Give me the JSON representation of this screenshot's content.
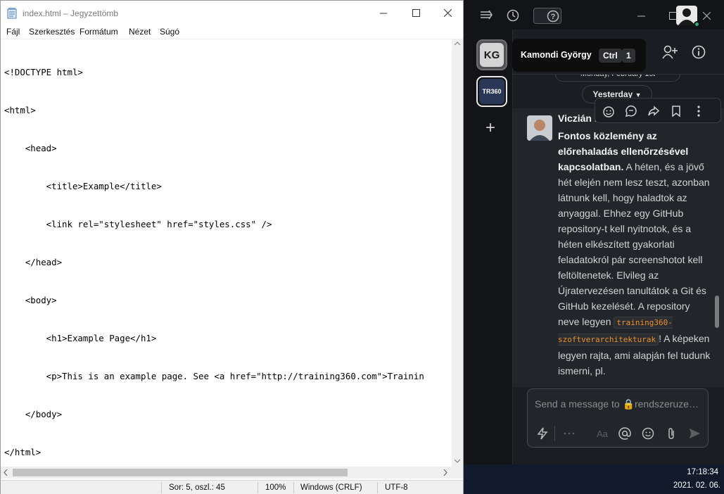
{
  "notepad": {
    "title": "index.html – Jegyzettömb",
    "menu": [
      "Fájl",
      "Szerkesztés",
      "Formátum",
      "Nézet",
      "Súgó"
    ],
    "lines": [
      "<!DOCTYPE html>",
      "<html>",
      "    <head>",
      "        <title>Example</title>",
      "        <link rel=\"stylesheet\" href=\"styles.css\" />",
      "    </head>",
      "    <body>",
      "        <h1>Example Page</h1>",
      "        <p>This is an example page. See <a href=\"http://training360.com\">Trainin",
      "    </body>",
      "</html>"
    ],
    "status": {
      "position": "Sor: 5, oszl.: 45",
      "zoom": "100%",
      "line_ending": "Windows (CRLF)",
      "encoding": "UTF-8"
    }
  },
  "slack": {
    "workspaces": [
      {
        "initials": "KG"
      },
      {
        "initials": "TR360"
      }
    ],
    "tooltip": {
      "name": "Kamondi György",
      "key1": "Ctrl",
      "key2": "1"
    },
    "date_divider_top": "Monday, February 1st",
    "date_divider": "Yesterday",
    "message": {
      "sender": "Viczián István",
      "body_bold": "Fontos közlemény az előrehaladás ellenőrzésével kapcsolatban.",
      "body_text": " A héten, és a jövő hét elején nem lesz teszt, azonban látnunk kell, hogy haladtok az anyaggal. Ehhez egy GitHub repository-t kell nyitnotok, és a héten elkészített gyakorlati feladatokról pár screenshotot kell feltöltenetek. Elvileg az Újratervezésen tanultátok a Git és GitHub kezelését. A repository neve legyen ",
      "code": "training360-szoftverarchitekturak",
      "body_tail": "! A képeken legyen rajta, ami alapján fel tudunk ismerni, pl."
    },
    "composer": {
      "placeholder": "Send a message to 🔒rendszeruze…"
    },
    "colors": {
      "accent_code": "#e8912d",
      "presence": "#2bac76"
    }
  },
  "taskbar": {
    "time": "17:18:34",
    "date": "2021. 02. 06."
  }
}
